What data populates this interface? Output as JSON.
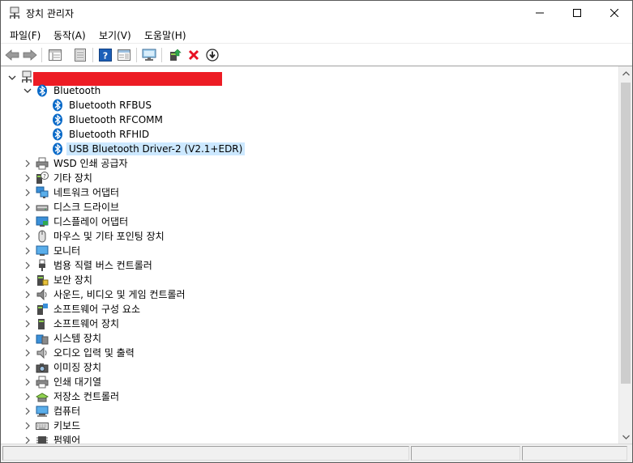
{
  "window": {
    "title": "장치 관리자",
    "minimize_icon": "minimize-icon",
    "maximize_icon": "maximize-icon",
    "close_icon": "close-icon"
  },
  "menu": {
    "file": "파일(F)",
    "action": "동작(A)",
    "view": "보기(V)",
    "help": "도움말(H)"
  },
  "toolbar": {
    "buttons": [
      "back-arrow-icon",
      "forward-arrow-icon",
      "properties-grid-icon",
      "document-icon",
      "help-icon",
      "action-panel-icon",
      "monitor-scan-icon",
      "update-driver-icon",
      "uninstall-x-icon",
      "download-arrow-icon"
    ],
    "colors": {
      "uninstall": "#e81123",
      "help": "#1c5fb8"
    }
  },
  "tree": {
    "root_label_redacted": true,
    "redaction_color": "#ed1c24",
    "bluetooth": {
      "label": "Bluetooth",
      "children": [
        "Bluetooth RFBUS",
        "Bluetooth RFCOMM",
        "Bluetooth RFHID",
        "USB Bluetooth Driver-2 (V2.1+EDR)"
      ],
      "selected_index": 3
    },
    "categories": [
      "WSD 인쇄 공급자",
      "기타 장치",
      "네트워크 어댑터",
      "디스크 드라이브",
      "디스플레이 어댑터",
      "마우스 및 기타 포인팅 장치",
      "모니터",
      "범용 직렬 버스 컨트롤러",
      "보안 장치",
      "사운드, 비디오 및 게임 컨트롤러",
      "소프트웨어 구성 요소",
      "소프트웨어 장치",
      "시스템 장치",
      "오디오 입력 및 출력",
      "이미징 장치",
      "인쇄 대기열",
      "저장소 컨트롤러",
      "컴퓨터",
      "키보드",
      "펌웨어"
    ],
    "selection_color": "#cce8ff"
  }
}
